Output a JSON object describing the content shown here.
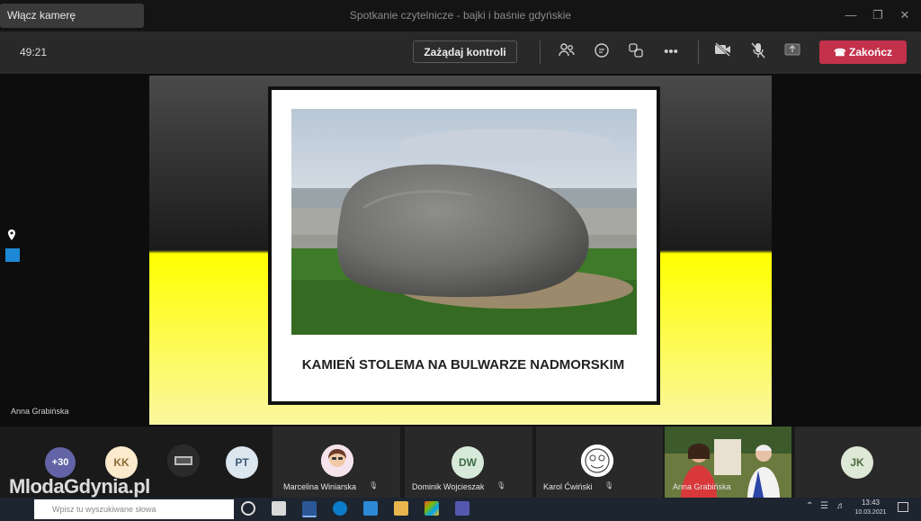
{
  "window": {
    "tab_label": "Włącz kamerę (Ctrl+Shift+O)",
    "title": "Spotkanie czytelnicze - bajki i baśnie gdyńskie"
  },
  "meeting": {
    "timer": "49:21",
    "control_label": "Zażądaj kontroli",
    "end_label": "Zakończ",
    "end_color": "#c4314b"
  },
  "slide": {
    "caption": "KAMIEŃ STOLEMA NA BULWARZE NADMORSKIM",
    "presenter": "Anna Grabińska"
  },
  "participants": {
    "overflow_count": "+30",
    "avatars": [
      {
        "initials": "KK",
        "color": "#fbeacb"
      },
      {
        "initials": "PT",
        "color": "#dbe6ef"
      },
      {
        "initials": "DW",
        "color": "#d7ead9"
      },
      {
        "initials": "JK",
        "color": "#dde8d6"
      }
    ],
    "named": [
      {
        "name": "Marcelina Winiarska"
      },
      {
        "name": "Dominik Wojcieszak"
      },
      {
        "name": "Karol Ćwiński"
      },
      {
        "name": "Anna Grabińska"
      }
    ]
  },
  "taskbar": {
    "search_placeholder": "Wpisz tu wyszukiwane słowa",
    "time": "13:43",
    "date": "10.03.2021"
  },
  "watermark": "MlodaGdynia.pl"
}
